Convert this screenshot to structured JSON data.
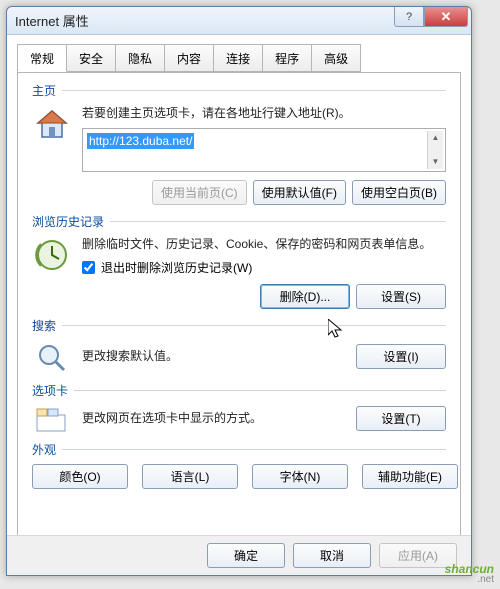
{
  "title": "Internet 属性",
  "tabs": [
    "常规",
    "安全",
    "隐私",
    "内容",
    "连接",
    "程序",
    "高级"
  ],
  "homepage": {
    "label": "主页",
    "desc": "若要创建主页选项卡，请在各地址行键入地址(R)。",
    "url": "http://123.duba.net/",
    "use_current": "使用当前页(C)",
    "use_default": "使用默认值(F)",
    "use_blank": "使用空白页(B)"
  },
  "history": {
    "label": "浏览历史记录",
    "desc": "删除临时文件、历史记录、Cookie、保存的密码和网页表单信息。",
    "checkbox": "退出时删除浏览历史记录(W)",
    "checked": true,
    "delete": "删除(D)...",
    "settings": "设置(S)"
  },
  "search": {
    "label": "搜索",
    "desc": "更改搜索默认值。",
    "settings": "设置(I)"
  },
  "tabgrp": {
    "label": "选项卡",
    "desc": "更改网页在选项卡中显示的方式。",
    "settings": "设置(T)"
  },
  "appearance": {
    "label": "外观",
    "color": "颜色(O)",
    "lang": "语言(L)",
    "font": "字体(N)",
    "access": "辅助功能(E)"
  },
  "buttons": {
    "ok": "确定",
    "cancel": "取消",
    "apply": "应用(A)"
  },
  "watermark": "shancun",
  "watermark_sub": ".net"
}
